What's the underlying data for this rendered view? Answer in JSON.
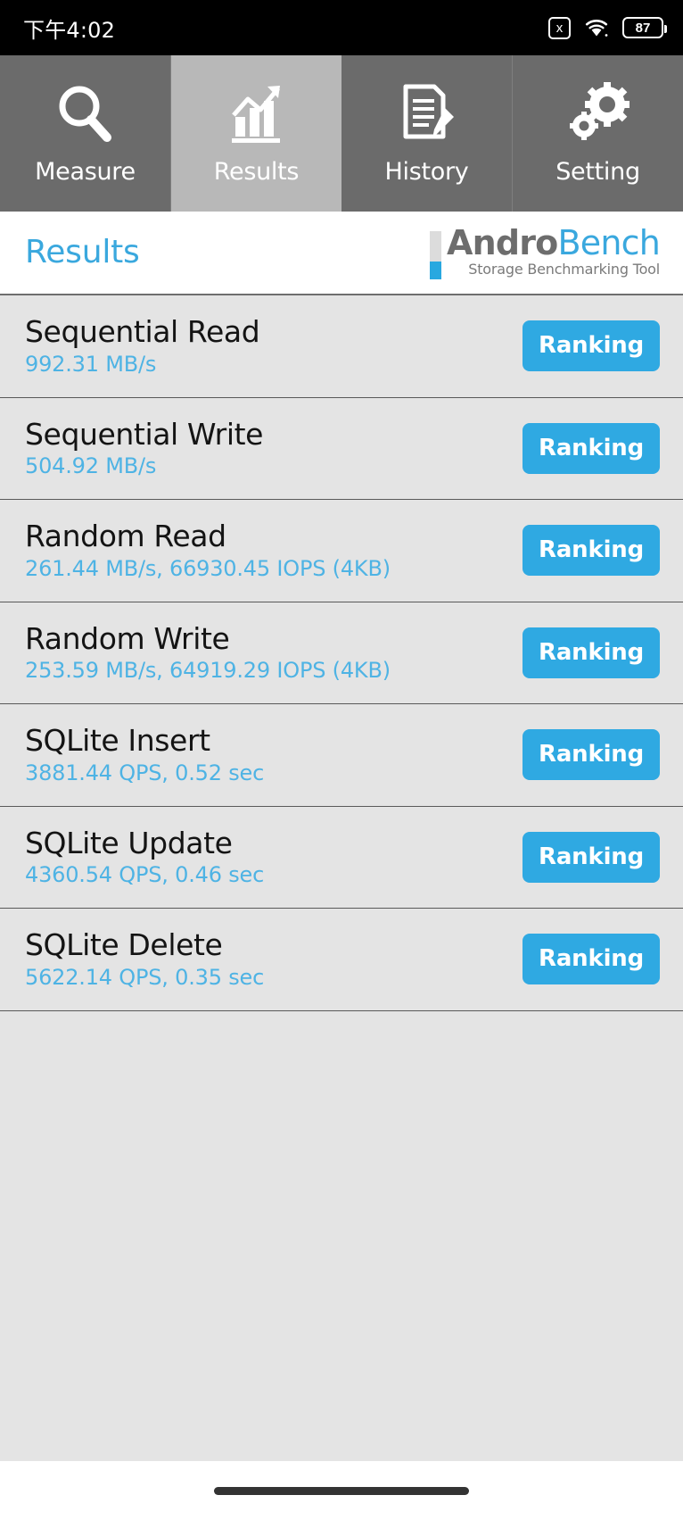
{
  "statusbar": {
    "time": "下午4:02",
    "xbox_icon_label": "x",
    "battery_level": "87"
  },
  "tabs": [
    {
      "label": "Measure",
      "icon": "magnifier-icon",
      "selected": false
    },
    {
      "label": "Results",
      "icon": "bar-chart-icon",
      "selected": true
    },
    {
      "label": "History",
      "icon": "document-pen-icon",
      "selected": false
    },
    {
      "label": "Setting",
      "icon": "gears-icon",
      "selected": false
    }
  ],
  "header": {
    "title": "Results",
    "brand_first": "Andro",
    "brand_second": "Bench",
    "brand_subtitle": "Storage Benchmarking Tool"
  },
  "colors": {
    "accent_blue": "#2fa9e2",
    "value_blue": "#4eb3e4",
    "title_blue": "#3aa8de",
    "tab_bg": "#6b6b6b",
    "tab_selected_bg": "#b8b8b8",
    "list_bg": "#e4e4e4"
  },
  "results": [
    {
      "title": "Sequential Read",
      "value": "992.31 MB/s",
      "button": "Ranking"
    },
    {
      "title": "Sequential Write",
      "value": "504.92 MB/s",
      "button": "Ranking"
    },
    {
      "title": "Random Read",
      "value": "261.44 MB/s, 66930.45 IOPS (4KB)",
      "button": "Ranking"
    },
    {
      "title": "Random Write",
      "value": "253.59 MB/s, 64919.29 IOPS (4KB)",
      "button": "Ranking"
    },
    {
      "title": "SQLite Insert",
      "value": "3881.44 QPS, 0.52 sec",
      "button": "Ranking"
    },
    {
      "title": "SQLite Update",
      "value": "4360.54 QPS, 0.46 sec",
      "button": "Ranking"
    },
    {
      "title": "SQLite Delete",
      "value": "5622.14 QPS, 0.35 sec",
      "button": "Ranking"
    }
  ]
}
